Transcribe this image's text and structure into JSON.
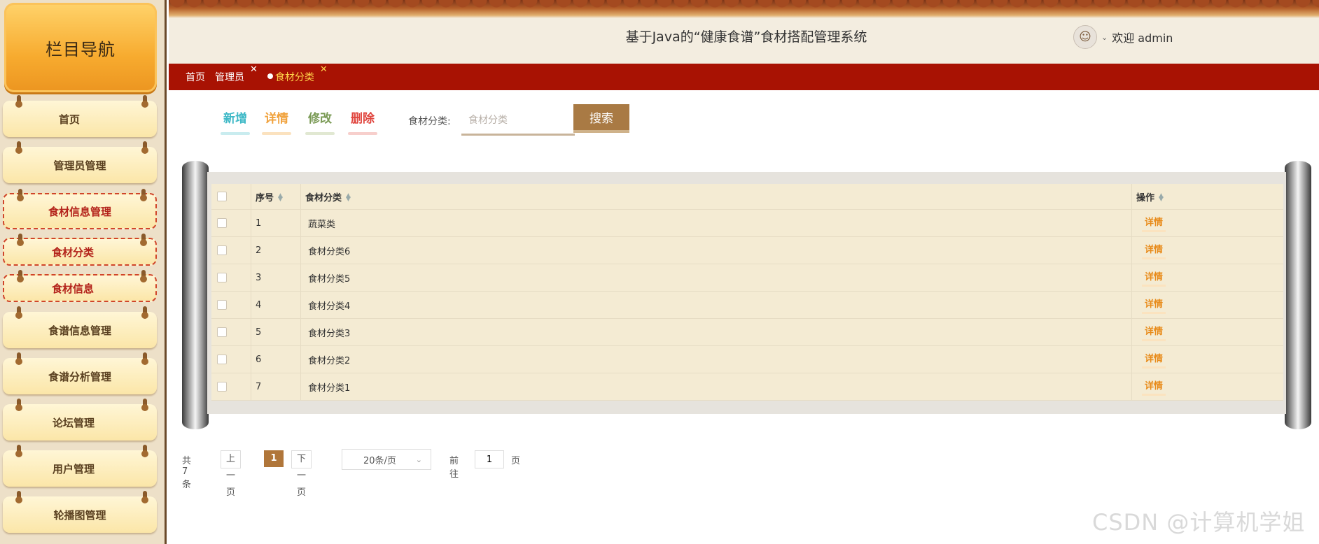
{
  "sidebar": {
    "title": "栏目导航",
    "items": [
      {
        "label": "首页",
        "active": false
      },
      {
        "label": "管理员管理",
        "active": false
      },
      {
        "label": "食材信息管理",
        "active": true
      },
      {
        "label": "食材分类",
        "active": true
      },
      {
        "label": "食材信息",
        "active": true
      },
      {
        "label": "食谱信息管理",
        "active": false
      },
      {
        "label": "食谱分析管理",
        "active": false
      },
      {
        "label": "论坛管理",
        "active": false
      },
      {
        "label": "用户管理",
        "active": false
      },
      {
        "label": "轮播图管理",
        "active": false
      }
    ]
  },
  "header": {
    "title": "基于Java的“健康食谱”食材搭配管理系统",
    "welcome": "欢迎 admin",
    "avatar_icon": "user-avatar-icon"
  },
  "tabs": [
    {
      "label": "首页",
      "closable": false
    },
    {
      "label": "管理员",
      "closable": true
    },
    {
      "label": "食材分类",
      "closable": true,
      "current": true
    }
  ],
  "toolbar": {
    "add": "新增",
    "detail": "详情",
    "edit": "修改",
    "delete": "删除",
    "search_label": "食材分类:",
    "search_placeholder": "食材分类",
    "search_button": "搜索"
  },
  "table": {
    "headers": {
      "index": "序号",
      "category": "食材分类",
      "actions": "操作"
    },
    "rows": [
      {
        "index": "1",
        "category": "蔬菜类",
        "action": "详情"
      },
      {
        "index": "2",
        "category": "食材分类6",
        "action": "详情"
      },
      {
        "index": "3",
        "category": "食材分类5",
        "action": "详情"
      },
      {
        "index": "4",
        "category": "食材分类4",
        "action": "详情"
      },
      {
        "index": "5",
        "category": "食材分类3",
        "action": "详情"
      },
      {
        "index": "6",
        "category": "食材分类2",
        "action": "详情"
      },
      {
        "index": "7",
        "category": "食材分类1",
        "action": "详情"
      }
    ]
  },
  "pager": {
    "total": "共 7 条",
    "prev": "上一页",
    "current": "1",
    "next": "下一页",
    "page_size": "20条/页",
    "goto": "前往",
    "goto_value": "1",
    "page_unit": "页"
  },
  "watermark": "CSDN @计算机学姐",
  "colors": {
    "tab_bar": "#a81203",
    "accent_brown": "#a97a44",
    "add": "#3fb9c7",
    "detail": "#f0a13b",
    "edit": "#7a9a55",
    "delete": "#e0463f"
  }
}
